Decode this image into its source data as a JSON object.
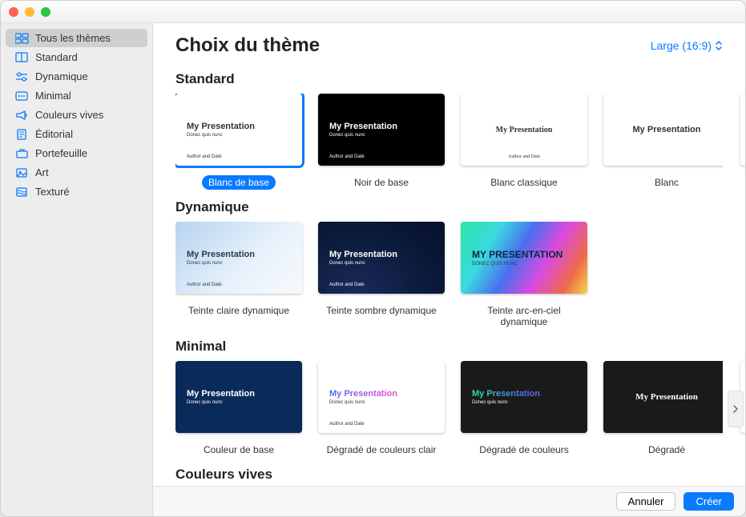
{
  "header": {
    "title": "Choix du thème",
    "size_label": "Large (16:9)"
  },
  "sidebar": {
    "items": [
      {
        "label": "Tous les thèmes",
        "icon": "grid-all"
      },
      {
        "label": "Standard",
        "icon": "grid"
      },
      {
        "label": "Dynamique",
        "icon": "sliders"
      },
      {
        "label": "Minimal",
        "icon": "dots"
      },
      {
        "label": "Couleurs vives",
        "icon": "megaphone"
      },
      {
        "label": "Éditorial",
        "icon": "document"
      },
      {
        "label": "Portefeuille",
        "icon": "briefcase"
      },
      {
        "label": "Art",
        "icon": "art"
      },
      {
        "label": "Texturé",
        "icon": "texture"
      }
    ],
    "selected_index": 0
  },
  "sections": [
    {
      "title": "Standard",
      "has_peek": true,
      "has_arrow": false,
      "themes": [
        {
          "label": "Blanc de base",
          "variant": "t-white",
          "selected": true,
          "title": "My Presentation",
          "sub": "Donec quis nunc",
          "foot": "Author and Date"
        },
        {
          "label": "Noir de base",
          "variant": "t-black",
          "selected": false,
          "title": "My Presentation",
          "sub": "Donec quis nunc",
          "foot": "Author and Date"
        },
        {
          "label": "Blanc classique",
          "variant": "t-classic",
          "selected": false,
          "title": "My Presentation",
          "sub": "",
          "foot": "Author and Date"
        },
        {
          "label": "Blanc",
          "variant": "t-blanc",
          "selected": false,
          "title": "My Presentation",
          "sub": "",
          "foot": ""
        }
      ]
    },
    {
      "title": "Dynamique",
      "has_peek": false,
      "has_arrow": false,
      "themes": [
        {
          "label": "Teinte claire dynamique",
          "variant": "t-light-dyn",
          "selected": false,
          "title": "My Presentation",
          "sub": "Donec quis nunc",
          "foot": "Author and Date"
        },
        {
          "label": "Teinte sombre dynamique",
          "variant": "t-dark-dyn",
          "selected": false,
          "title": "My Presentation",
          "sub": "Donec quis nunc",
          "foot": "Author and Date"
        },
        {
          "label": "Teinte arc-en-ciel dynamique",
          "variant": "t-rainbow",
          "selected": false,
          "title": "MY PRESENTATION",
          "sub": "DONEC QUIS NUNC",
          "foot": ""
        }
      ]
    },
    {
      "title": "Minimal",
      "has_peek": true,
      "has_arrow": true,
      "themes": [
        {
          "label": "Couleur de base",
          "variant": "t-color-base",
          "selected": false,
          "title": "My Presentation",
          "sub": "Donec quis nunc",
          "foot": ""
        },
        {
          "label": "Dégradé de couleurs clair",
          "variant": "t-grad-light",
          "selected": false,
          "title": "My Presentation",
          "sub": "Donec quis nunc",
          "foot": "Author and Date"
        },
        {
          "label": "Dégradé de couleurs",
          "variant": "t-grad-color",
          "selected": false,
          "title": "My Presentation",
          "sub": "Donec quis nunc",
          "foot": ""
        },
        {
          "label": "Dégradé",
          "variant": "t-grad",
          "selected": false,
          "title": "My Presentation",
          "sub": "",
          "foot": ""
        }
      ]
    },
    {
      "title": "Couleurs vives",
      "has_peek": false,
      "has_arrow": false,
      "themes": []
    }
  ],
  "footer": {
    "cancel": "Annuler",
    "create": "Créer"
  }
}
